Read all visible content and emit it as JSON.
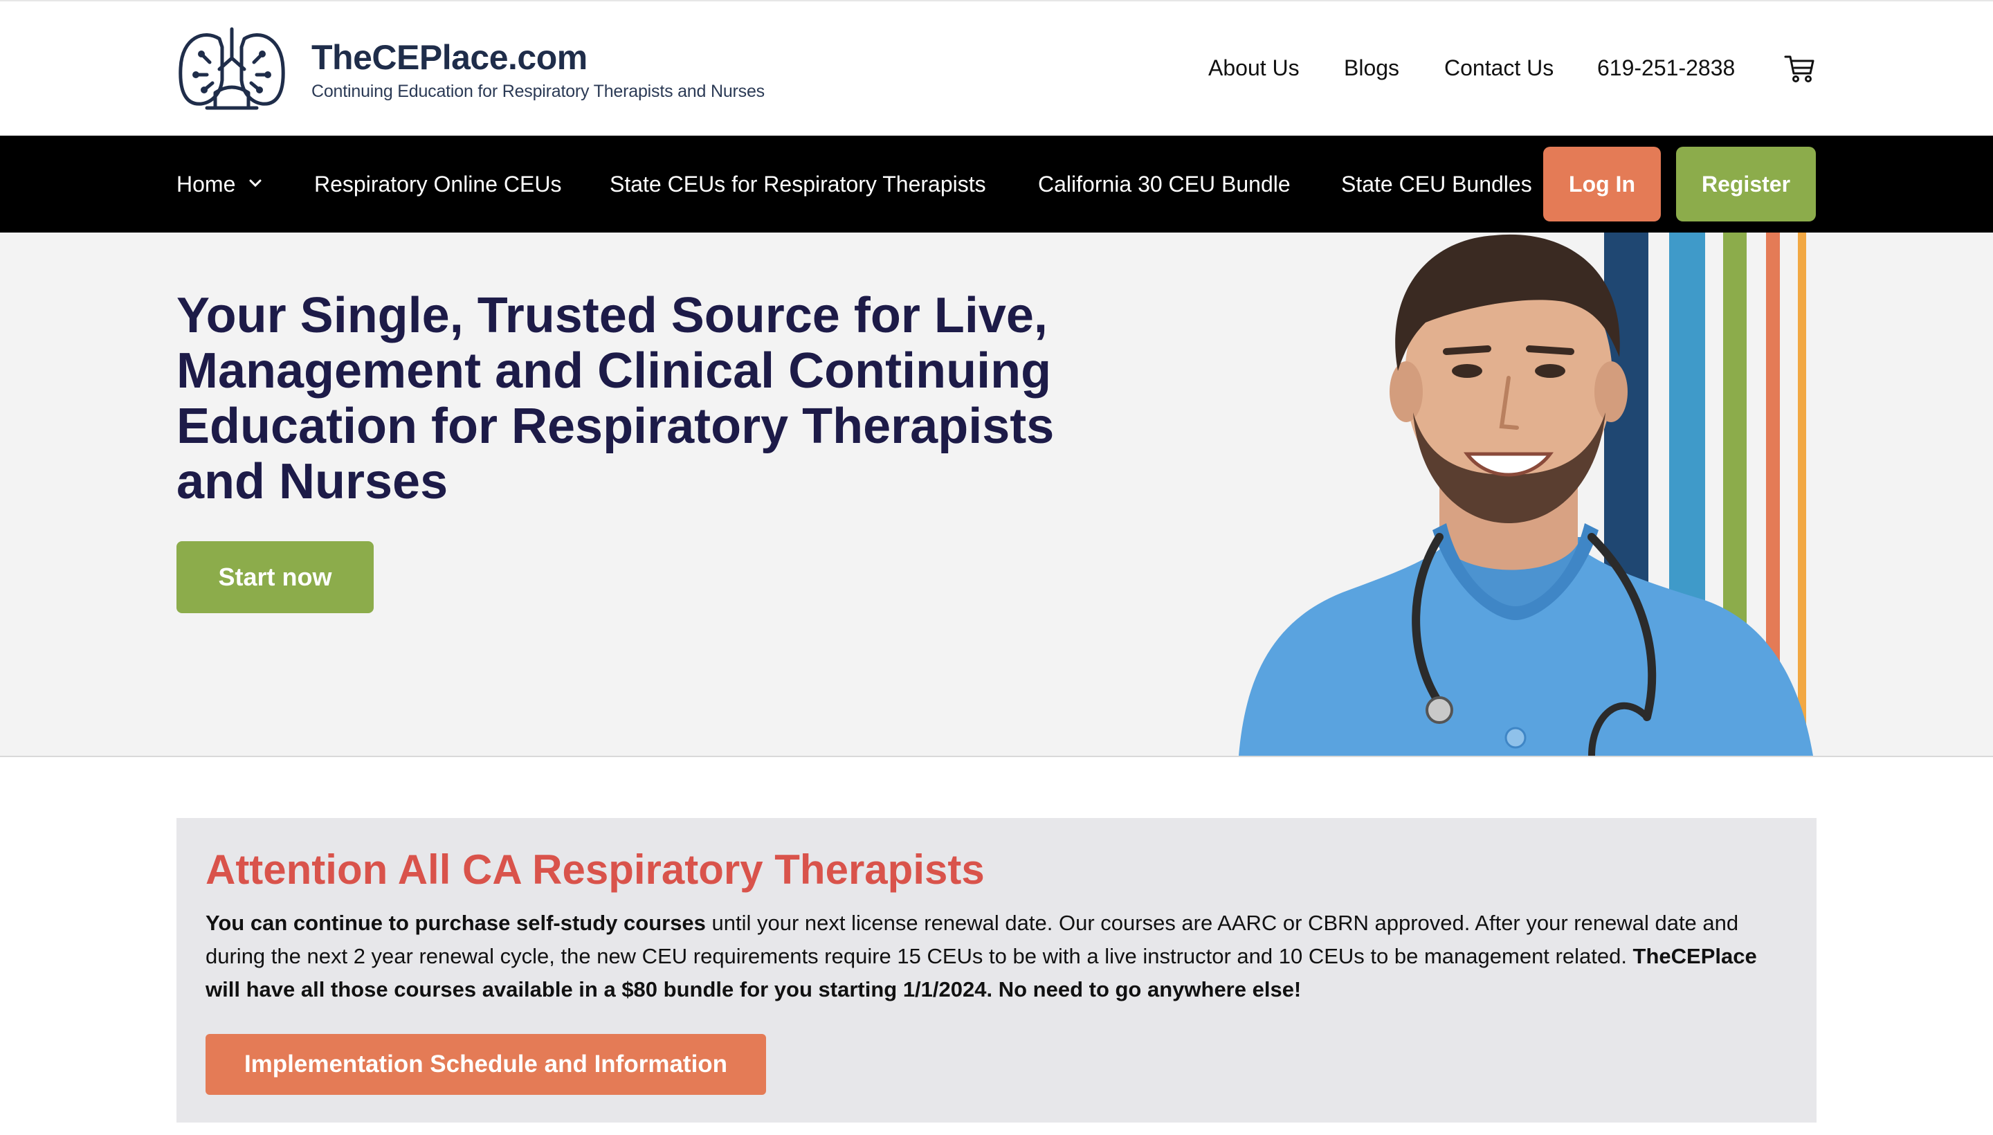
{
  "brand": {
    "name": "TheCEPlace.com",
    "tagline": "Continuing Education for Respiratory Therapists and Nurses"
  },
  "top_links": {
    "about": "About Us",
    "blogs": "Blogs",
    "contact": "Contact Us",
    "phone": "619-251-2838",
    "cart_icon": "shopping-cart-icon"
  },
  "nav": {
    "home": "Home",
    "respiratory_online": "Respiratory Online CEUs",
    "state_ceus": "State CEUs for Respiratory Therapists",
    "california_bundle": "California 30 CEU Bundle",
    "state_bundles": "State CEU Bundles",
    "login": "Log In",
    "register": "Register"
  },
  "hero": {
    "title": "Your Single, Trusted Source for Live, Management and Clinical Continuing Education for Respiratory Therapists and Nurses",
    "cta": "Start now"
  },
  "notice": {
    "title": "Attention All CA Respiratory Therapists",
    "body_bold_1": "You can continue to purchase self-study courses",
    "body_text": " until your next license renewal date. Our courses are AARC or CBRN approved. After your renewal date and during the next 2 year renewal cycle, the new CEU requirements require 15 CEUs to be with a live instructor and 10 CEUs to be management related. ",
    "body_bold_2": "TheCEPlace will have all those courses available in a $80 bundle for you starting 1/1/2024. No need to go anywhere else!",
    "button": "Implementation Schedule and Information"
  },
  "colors": {
    "nav_bg": "#000000",
    "login": "#e47b56",
    "register": "#8cac4b",
    "hero_title": "#1d1b48",
    "notice_title": "#d9534b",
    "stripes": [
      "#1f4772",
      "#3f9ac9",
      "#8cac4b",
      "#e47b56",
      "#f2a843"
    ]
  }
}
